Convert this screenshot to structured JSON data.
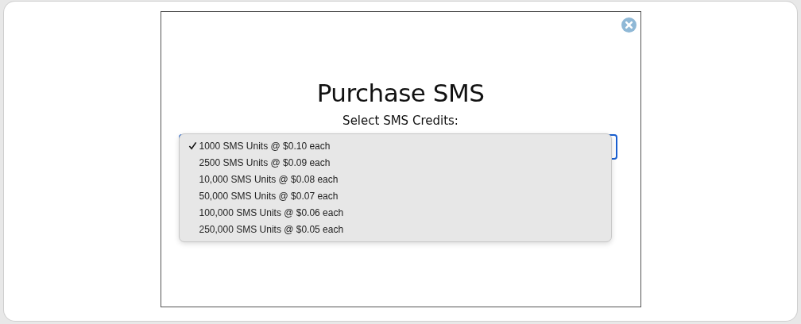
{
  "dialog": {
    "title": "Purchase SMS",
    "label": "Select SMS Credits:"
  },
  "dropdown": {
    "options": [
      {
        "label": "1000 SMS Units @ $0.10 each",
        "selected": true
      },
      {
        "label": "2500 SMS Units @ $0.09 each",
        "selected": false
      },
      {
        "label": "10,000 SMS Units @ $0.08 each",
        "selected": false
      },
      {
        "label": "50,000 SMS Units @ $0.07 each",
        "selected": false
      },
      {
        "label": "100,000 SMS Units @ $0.06 each",
        "selected": false
      },
      {
        "label": "250,000 SMS Units @ $0.05 each",
        "selected": false
      }
    ]
  }
}
